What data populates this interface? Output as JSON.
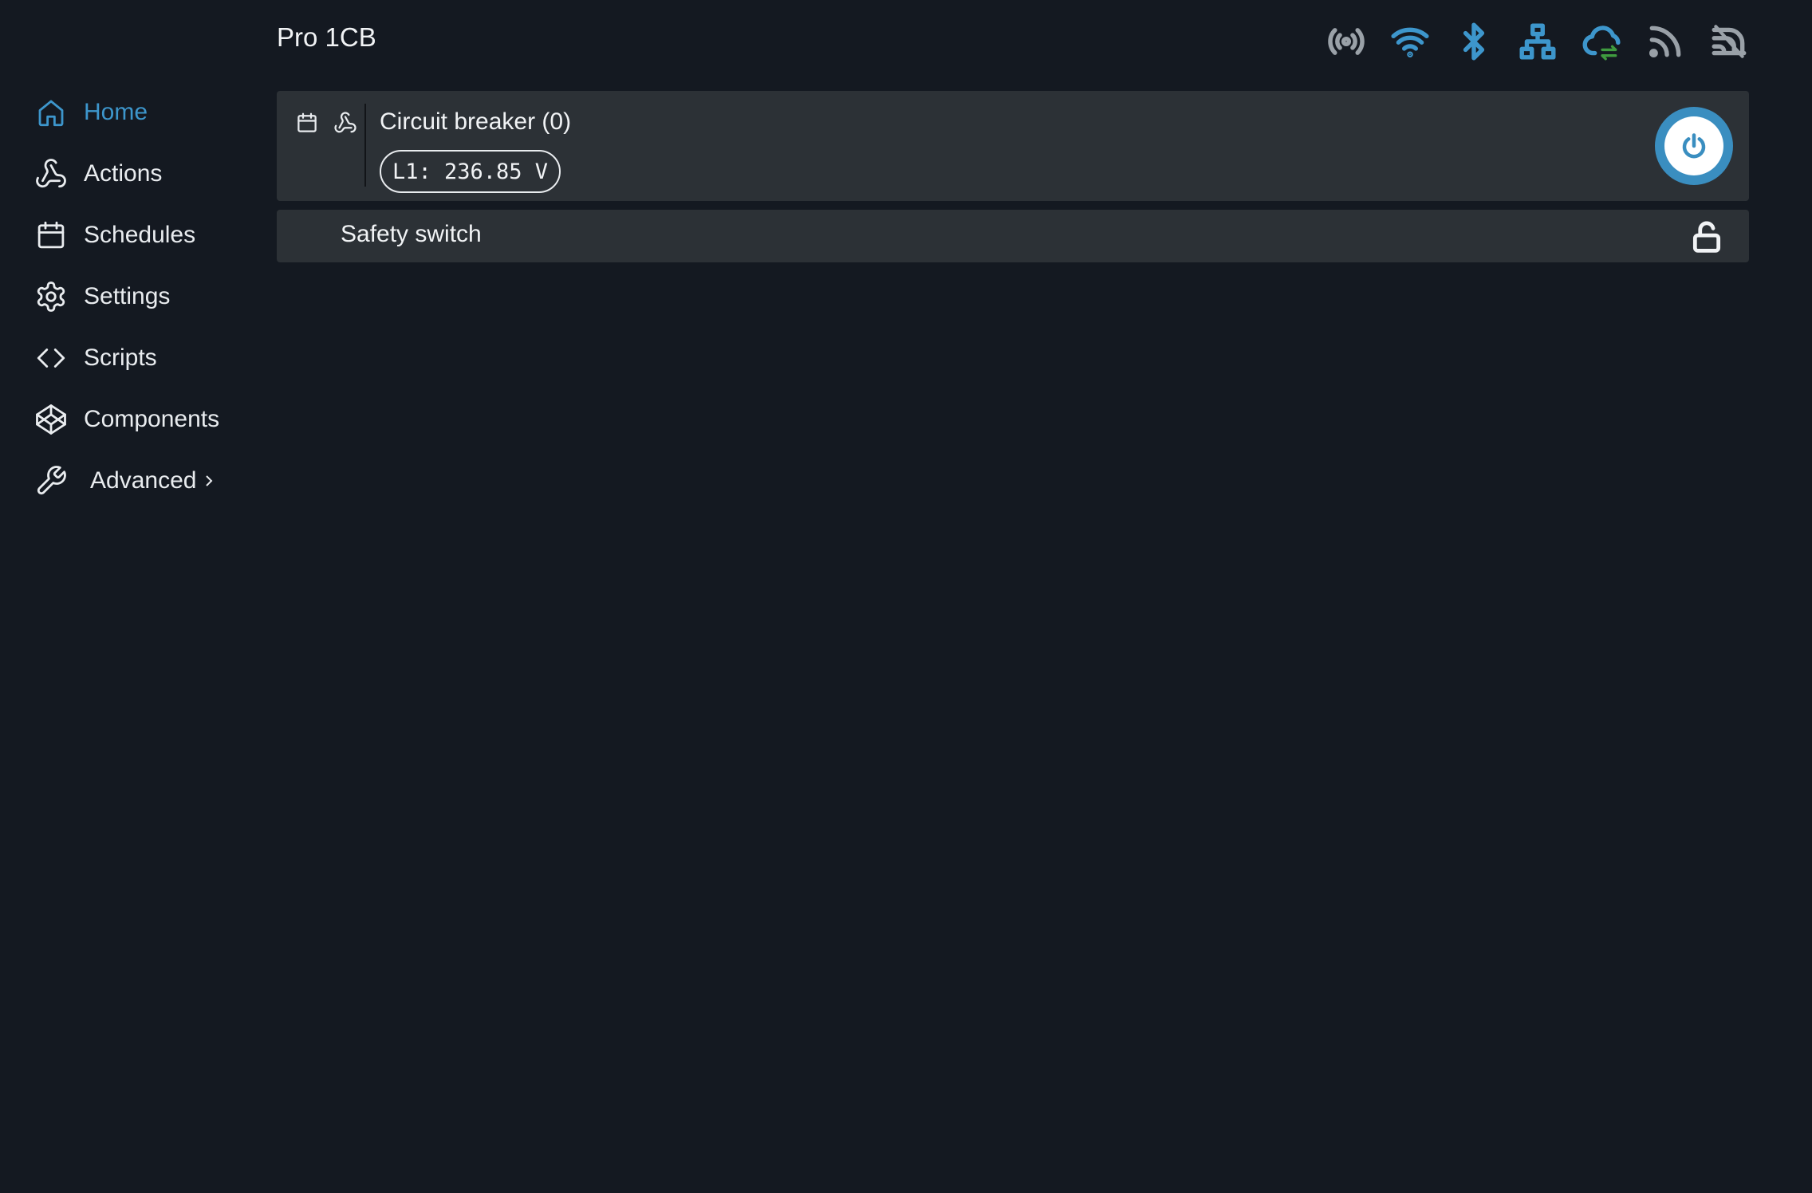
{
  "app": {
    "title": "Pro 1CB"
  },
  "sidebar": {
    "items": [
      {
        "label": "Home",
        "icon": "home-icon",
        "active": true
      },
      {
        "label": "Actions",
        "icon": "webhook-icon"
      },
      {
        "label": "Schedules",
        "icon": "calendar-icon"
      },
      {
        "label": "Settings",
        "icon": "gear-icon"
      },
      {
        "label": "Scripts",
        "icon": "code-icon"
      },
      {
        "label": "Components",
        "icon": "codepen-icon"
      },
      {
        "label": "Advanced",
        "icon": "wrench-icon",
        "has_submenu": true
      }
    ]
  },
  "status_icons": [
    {
      "name": "broadcast-icon",
      "color": "#9aa1a8"
    },
    {
      "name": "wifi-icon",
      "color": "#3d96cc"
    },
    {
      "name": "bluetooth-icon",
      "color": "#3d96cc"
    },
    {
      "name": "ethernet-icon",
      "color": "#3d96cc"
    },
    {
      "name": "cloud-icon",
      "color": "#3d96cc",
      "accent": "#3f9b3f"
    },
    {
      "name": "rss-icon",
      "color": "#9aa1a8"
    },
    {
      "name": "mqtt-icon",
      "color": "#9aa1a8"
    }
  ],
  "components": {
    "circuit_breaker": {
      "name": "Circuit breaker (0)",
      "badge": "L1: 236.85 V",
      "icons": [
        "calendar-icon",
        "webhook-icon"
      ],
      "state": "on",
      "accent": "#3a8ec0"
    },
    "safety_switch": {
      "name": "Safety switch",
      "icon": "unlock-icon"
    }
  },
  "colors": {
    "background": "#141921",
    "card": "#2c3136",
    "accent": "#3d96cc"
  }
}
